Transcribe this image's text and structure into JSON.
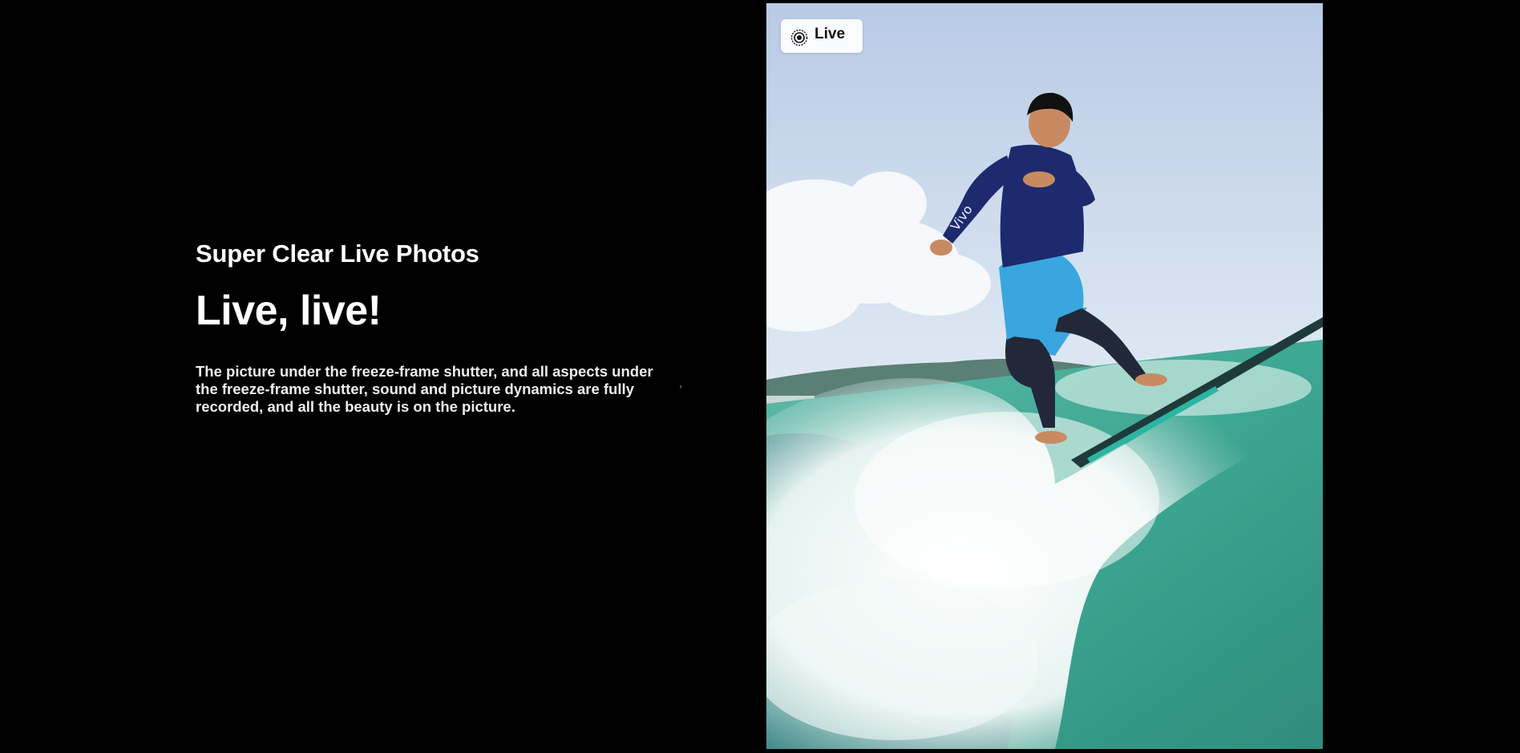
{
  "hero": {
    "eyebrow": "Super Clear Live Photos",
    "headline": "Live, live!",
    "body": "The picture under the freeze-frame shutter, and all aspects under the freeze-frame shutter, sound and picture dynamics are fully recorded, and all the beauty is on the picture."
  },
  "photo": {
    "badge_label": "Live",
    "badge_icon": "live-photo-icon",
    "sleeve_text": "Vivo",
    "colors": {
      "sky": "#c3d3ea",
      "wetsuit": "#1e2a6e",
      "shorts": "#3aa6df",
      "water": "#3fb29a",
      "board": "#1f3a3a"
    }
  },
  "decor": {
    "stray_mark": ","
  }
}
